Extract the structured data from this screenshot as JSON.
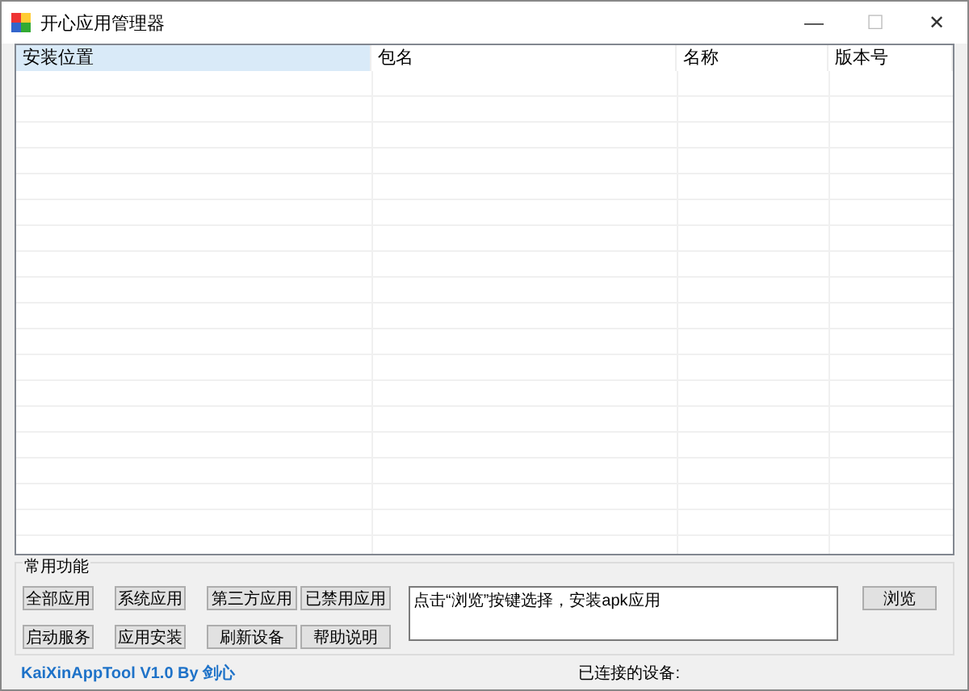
{
  "window": {
    "title": "开心应用管理器",
    "controls": [
      "—",
      "☐",
      "✕"
    ]
  },
  "table": {
    "columns": [
      {
        "label": "安装位置",
        "selected": true
      },
      {
        "label": "包名",
        "selected": false
      },
      {
        "label": "名称",
        "selected": false
      },
      {
        "label": "版本号",
        "selected": false
      }
    ]
  },
  "group": {
    "title": "常用功能",
    "buttons": [
      {
        "label": "全部应用"
      },
      {
        "label": "系统应用"
      },
      {
        "label": "第三方应用"
      },
      {
        "label": "已禁用应用"
      },
      {
        "label": "启动服务"
      },
      {
        "label": "应用安装"
      },
      {
        "label": "刷新设备"
      },
      {
        "label": "帮助说明"
      }
    ],
    "apk_box": {
      "value": "点击“浏览”按键选择，安装apk应用"
    },
    "browse_button": "浏览"
  },
  "status_bar": {
    "credit": "KaiXinAppTool V1.0 By 剑心",
    "device_label": "已连接的设备:"
  }
}
